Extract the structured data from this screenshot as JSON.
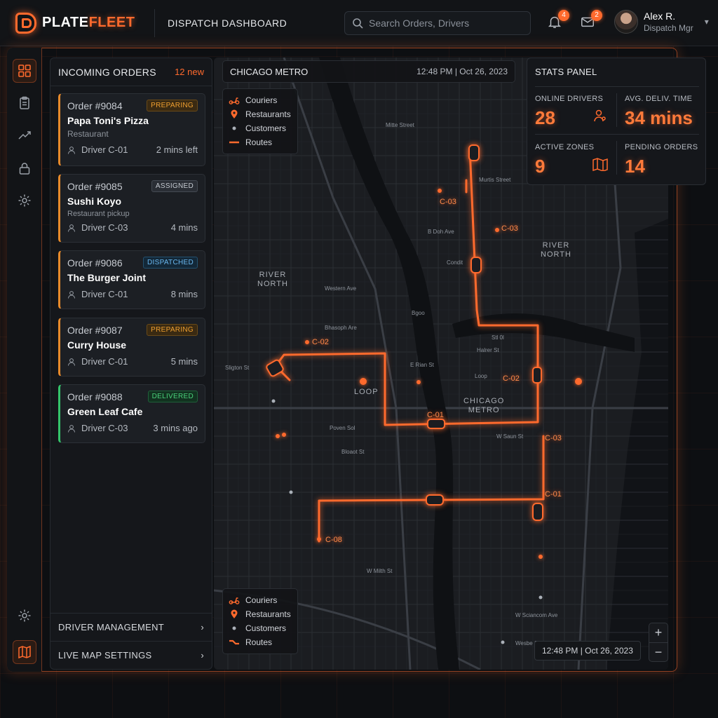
{
  "brand": {
    "name_part1": "PLATE",
    "name_part2": "FLEET"
  },
  "header": {
    "page_title": "DISPATCH DASHBOARD",
    "search_placeholder": "Search Orders, Drivers",
    "notifications_count": "4",
    "messages_count": "2",
    "user_name": "Alex R.",
    "user_role": "Dispatch Mgr"
  },
  "sidebar": {
    "items": [
      {
        "icon": "dashboard-grid-icon",
        "active": true
      },
      {
        "icon": "clipboard-icon",
        "active": false
      },
      {
        "icon": "analytics-trend-icon",
        "active": false
      },
      {
        "icon": "lock-icon",
        "active": false
      },
      {
        "icon": "gear-icon",
        "active": false
      }
    ],
    "bottom": [
      {
        "icon": "settings-icon"
      },
      {
        "icon": "map-icon"
      }
    ]
  },
  "orders": {
    "title": "INCOMING ORDERS",
    "new_count": "12 new",
    "items": [
      {
        "id": "Order #9084",
        "status": "PREPARING",
        "restaurant": "Papa Toni's Pizza",
        "sub": "Restaurant",
        "driver": "Driver C-01",
        "time": "2 mins left"
      },
      {
        "id": "Order #9085",
        "status": "ASSIGNED",
        "restaurant": "Sushi Koyo",
        "sub": "Restaurant pickup",
        "driver": "Driver C-03",
        "time": "4 mins"
      },
      {
        "id": "Order #9086",
        "status": "DISPATCHED",
        "restaurant": "The Burger Joint",
        "sub": "",
        "driver": "Driver C-01",
        "time": "8 mins"
      },
      {
        "id": "Order #9087",
        "status": "PREPARING",
        "restaurant": "Curry House",
        "sub": "",
        "driver": "Driver C-01",
        "time": "5 mins"
      },
      {
        "id": "Order #9088",
        "status": "DELIVERED",
        "restaurant": "Green Leaf Cafe",
        "sub": "",
        "driver": "Driver C-03",
        "time": "3 mins ago"
      }
    ],
    "footer": {
      "driver_management": "DRIVER MANAGEMENT",
      "live_map_settings": "LIVE MAP SETTINGS"
    }
  },
  "map": {
    "title": "CHICAGO METRO",
    "datetime": "12:48 PM | Oct 26, 2023",
    "legend": [
      "Couriers",
      "Restaurants",
      "Customers",
      "Routes"
    ],
    "districts": {
      "river_north_left": "RIVER\nNORTH",
      "river_north_right": "RIVER\nNORTH",
      "chicago_metro": "CHICAGO\nMETRO",
      "loop": "LOOP"
    },
    "streets": [
      "Mitte Street",
      "Murtis Street",
      "B Doh Ave",
      "Condit",
      "Western Ave",
      "Bhasoph Are",
      "Sligton St",
      "E Rian St",
      "Halrer St",
      "Loop",
      "Poven Sol",
      "Bloaot St",
      "W Saun St",
      "W Milth St",
      "W Sciancom Ave",
      "Wesbe Strnet",
      "Stl 0l",
      "Bgoo"
    ],
    "drivers": [
      "C-03",
      "C-03",
      "C-02",
      "C-02",
      "C-01",
      "C-03",
      "C-01",
      "C-08"
    ],
    "zoom_in": "+",
    "zoom_out": "−",
    "time_chip": "12:48 PM | Oct 26, 2023",
    "accent_color": "#ff6a2d"
  },
  "stats": {
    "title": "STATS PANEL",
    "online_drivers_label": "ONLINE DRIVERS",
    "online_drivers_value": "28",
    "avg_delivery_label": "AVG. DELIV. TIME",
    "avg_delivery_value": "34 mins",
    "active_zones_label": "ACTIVE ZONES",
    "active_zones_value": "9",
    "pending_orders_label": "PENDING ORDERS",
    "pending_orders_value": "14"
  }
}
